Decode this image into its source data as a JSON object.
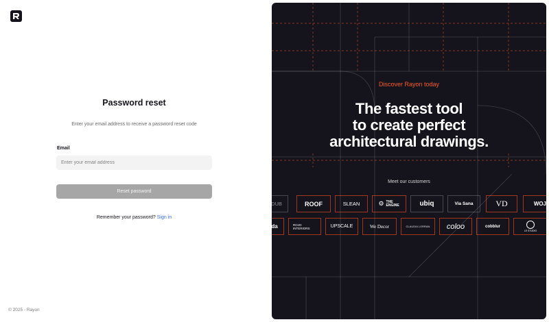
{
  "left": {
    "title": "Password reset",
    "subtitle": "Enter your email address to receive a password reset code",
    "email_label": "Email",
    "email_placeholder": "Enter your email address",
    "reset_button": "Reset password",
    "remember_text": "Remember your password?",
    "signin_link": "Sign in",
    "footer": "© 2025 - Rayon"
  },
  "hero": {
    "kicker": "Discover Rayon today",
    "headline_1": "The fastest tool",
    "headline_2": "to create perfect",
    "headline_3": "architectural drawings.",
    "meet": "Meet our customers"
  },
  "customers_row1": [
    "DUB",
    "ROOF",
    "SLEAN",
    "THE ENGINE",
    "ubiq",
    "Via Sana",
    "VD",
    "WOJ"
  ],
  "customers_row2": [
    "da",
    "ROJO INTERIORS",
    "UPSCALE",
    "We Decor",
    "CLAUDIA LORRAN",
    "coloo",
    "cobblur",
    "LE STUDIO"
  ],
  "colors": {
    "accent": "#ff5a1f",
    "link": "#2f6fe4",
    "hero_bg": "#15141c",
    "button_disabled": "#a6a6a6"
  }
}
